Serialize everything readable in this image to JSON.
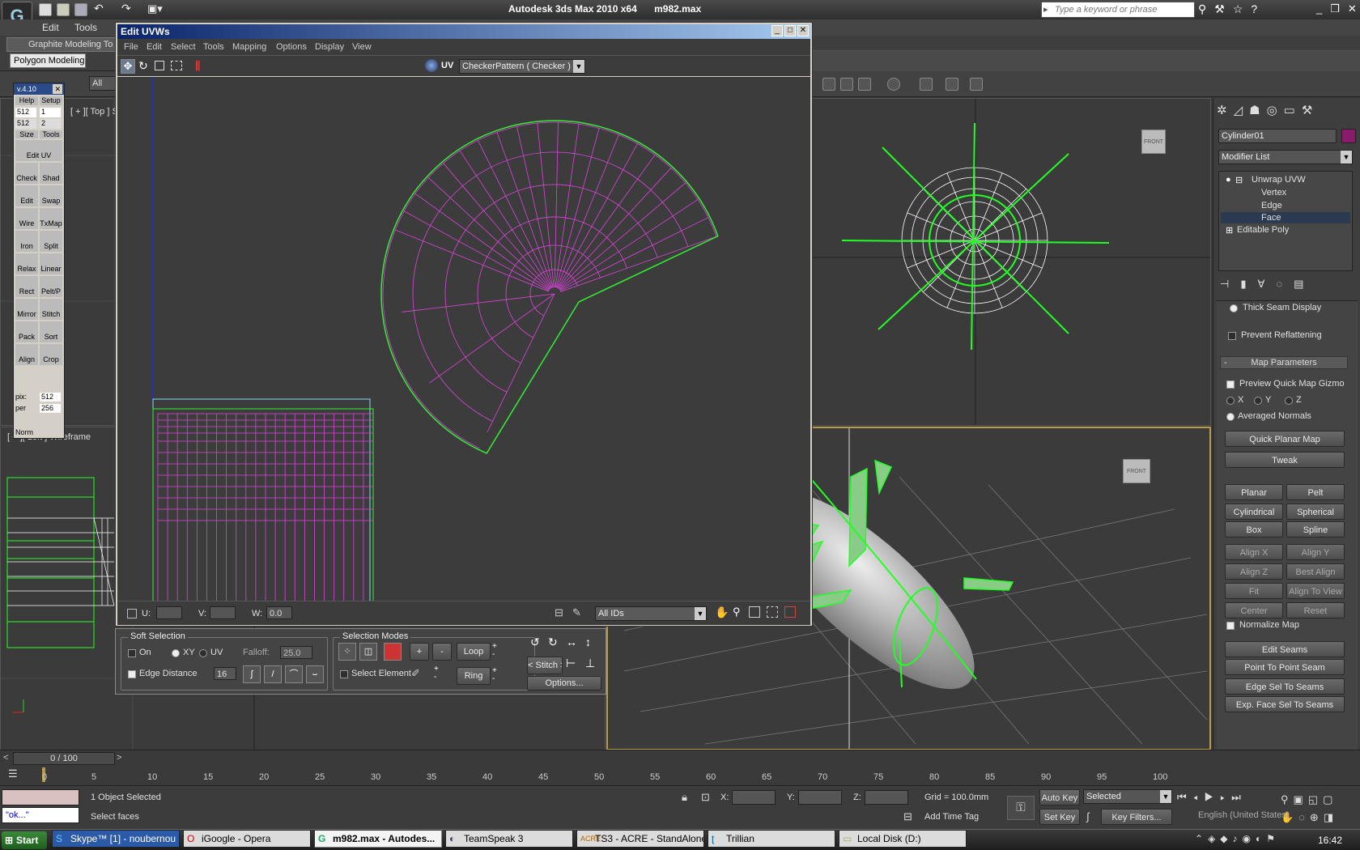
{
  "app": {
    "title": "Autodesk 3ds Max  2010 x64",
    "filename": "m982.max",
    "search_placeholder": "Type a keyword or phrase",
    "menu": [
      "Edit",
      "Tools"
    ],
    "ribbon_tab": "Graphite Modeling To",
    "ribbon_sub": "Polygon Modeling",
    "filter_label": "All"
  },
  "texporter": {
    "version": "v.4.10",
    "help": "Help",
    "setup": "Setup",
    "v512a": "512",
    "v1": "1",
    "v512b": "512",
    "v2": "2",
    "size": "Size",
    "tools": "Tools",
    "tools_labels": [
      "Edit UV",
      "Check",
      "Shad",
      "Edit",
      "Swap",
      "Wire",
      "TxMap",
      "Iron",
      "Split",
      "Relax",
      "Linear",
      "Rect",
      "Pelt/P",
      "Mirror",
      "Stitch",
      "Pack",
      "Sort",
      "Align",
      "Crop"
    ],
    "pix": "pix:",
    "pix_val": "512",
    "per": "per",
    "per_val": "256",
    "norm": "Norm"
  },
  "viewport_labels": {
    "top_left": "[ + ][ Top ] Smooth + Edge",
    "bottom_left": "[ + ][ Left ] Wireframe",
    "front_cube": "FRONT"
  },
  "uvw": {
    "title": "Edit UVWs",
    "menu": [
      "File",
      "Edit",
      "Select",
      "Tools",
      "Mapping",
      "Options",
      "Display",
      "View"
    ],
    "uv_label": "UV",
    "checker": "CheckerPattern  ( Checker )",
    "u_label": "U:",
    "v_label": "V:",
    "w_label": "W:",
    "w_value": "0.0",
    "ids": "All IDs"
  },
  "softsel": {
    "title": "Soft Selection",
    "on": "On",
    "xy": "XY",
    "uv": "UV",
    "falloff_label": "Falloff:",
    "falloff_value": "25.0",
    "edge_distance": "Edge Distance",
    "edge_value": "16"
  },
  "selmodes": {
    "title": "Selection Modes",
    "select_element": "Select Element",
    "plus": "+",
    "minus": "-",
    "loop": "Loop",
    "ring": "Ring",
    "stitch": "< Stitch >",
    "options": "Options..."
  },
  "cmdpanel": {
    "object_name": "Cylinder01",
    "object_color": "#8a1b6b",
    "modifier_list": "Modifier List",
    "stack": [
      "Unwrap UVW",
      "Vertex",
      "Edge",
      "Face",
      "Editable Poly"
    ],
    "thick_seam": "Thick Seam Display",
    "prevent_reflat": "Prevent Reflattening",
    "map_params": "Map Parameters",
    "preview_gizmo": "Preview Quick Map Gizmo",
    "x": "X",
    "y": "Y",
    "z": "Z",
    "averaged": "Averaged Normals",
    "quick_planar": "Quick Planar Map",
    "tweak": "Tweak",
    "planar": "Planar",
    "pelt": "Pelt",
    "cylindrical": "Cylindrical",
    "spherical": "Spherical",
    "box": "Box",
    "spline": "Spline",
    "align_x": "Align X",
    "align_y": "Align Y",
    "align_z": "Align Z",
    "best_align": "Best Align",
    "fit": "Fit",
    "align_view": "Align To View",
    "center": "Center",
    "reset": "Reset",
    "normalize": "Normalize Map",
    "edit_seams": "Edit Seams",
    "point_seam": "Point To Point Seam",
    "edge_sel": "Edge Sel To Seams",
    "exp_face": "Exp. Face Sel To Seams"
  },
  "timeline": {
    "frame": "0 / 100",
    "ticks": [
      "0",
      "5",
      "10",
      "15",
      "20",
      "25",
      "30",
      "35",
      "40",
      "45",
      "50",
      "55",
      "60",
      "65",
      "70",
      "75",
      "80",
      "85",
      "90",
      "95",
      "100"
    ]
  },
  "status": {
    "maxscript": "\"ok...\"",
    "selected": "1 Object Selected",
    "prompt": "Select faces",
    "x": "X:",
    "y": "Y:",
    "z": "Z:",
    "grid": "Grid = 100.0mm",
    "add_time_tag": "Add Time Tag",
    "auto_key": "Auto Key",
    "set_key": "Set Key",
    "key_mode": "Selected",
    "key_filters": "Key Filters..."
  },
  "taskbar": {
    "start": "Start",
    "items": [
      "Skype™ [1] - noubernou",
      "iGoogle - Opera",
      "m982.max - Autodes...",
      "TeamSpeak 3",
      "TS3 - ACRE - StandAlone...",
      "Trillian",
      "Local Disk (D:)"
    ],
    "lang": "English (United States)",
    "clock": "16:42"
  }
}
